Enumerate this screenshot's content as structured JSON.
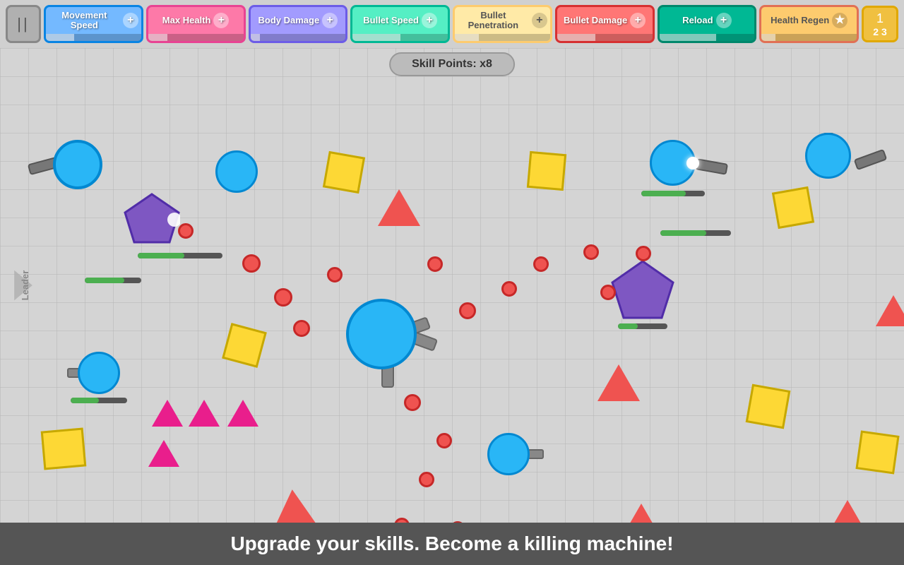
{
  "topBar": {
    "pauseLabel": "||",
    "skills": [
      {
        "id": "movement",
        "label": "Movement\nSpeed",
        "color": "movement",
        "barFill": 30
      },
      {
        "id": "maxhealth",
        "label": "Max\nHealth",
        "color": "maxhealth",
        "barFill": 20
      },
      {
        "id": "bodydmg",
        "label": "Body\nDamage",
        "color": "bodydmg",
        "barFill": 10
      },
      {
        "id": "bulletspd",
        "label": "Bullet\nSpeed",
        "color": "bulletspd",
        "barFill": 50
      },
      {
        "id": "bulletpen",
        "label": "Bullet\nPenetration",
        "color": "bulletpen",
        "barFill": 25
      },
      {
        "id": "bulletdmg",
        "label": "Bullet\nDamage",
        "color": "bulletdmg",
        "barFill": 40
      },
      {
        "id": "reload",
        "label": "Reload",
        "color": "reload",
        "barFill": 60
      },
      {
        "id": "healthregen",
        "label": "Health\nRegen",
        "color": "healthregen",
        "barFill": 15
      }
    ],
    "levelBadge": {
      "icon": "★",
      "level": "1\n2 3"
    }
  },
  "skillPoints": {
    "label": "Skill Points: x8"
  },
  "leader": {
    "label": "Leader"
  },
  "bottomBar": {
    "tagline": "Upgrade your skills. Become a killing machine!"
  }
}
